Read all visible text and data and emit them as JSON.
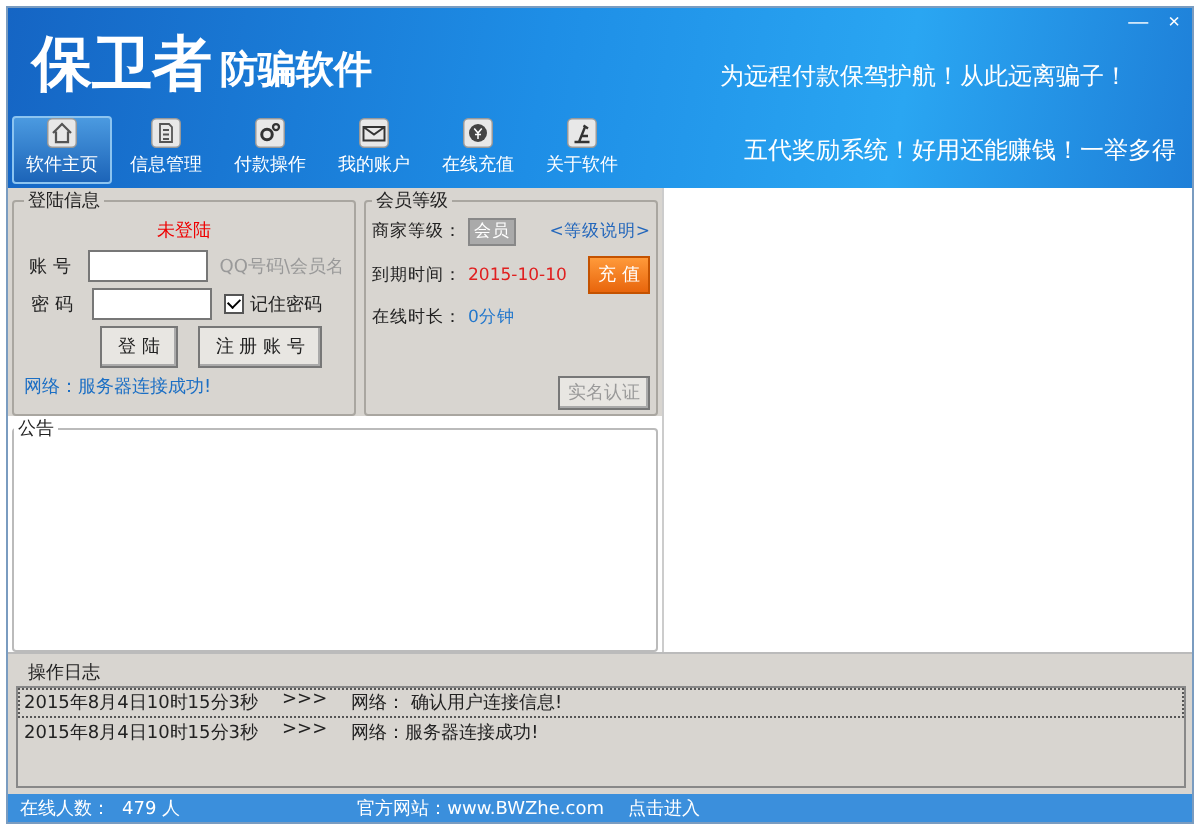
{
  "window": {
    "title_main": "保卫者",
    "title_sub": "防骗软件",
    "slogans": [
      "为远程付款保驾护航！从此远离骗子！",
      "五代奖励系统！好用还能赚钱！一举多得"
    ],
    "controls": [
      "—",
      "×"
    ]
  },
  "tabs": [
    {
      "label": "软件主页",
      "selected": true
    },
    {
      "label": "信息管理",
      "selected": false
    },
    {
      "label": "付款操作",
      "selected": false
    },
    {
      "label": "我的账户",
      "selected": false
    },
    {
      "label": "在线充值",
      "selected": false
    },
    {
      "label": "关于软件",
      "selected": false
    }
  ],
  "login": {
    "title": "登陆信息",
    "status": "未登陆",
    "account_label": "账 号",
    "account_hint": "QQ号码\\会员名",
    "password_label": "密 码",
    "remember": {
      "label": "记住密码",
      "checked": true
    },
    "buttons": [
      "登 陆",
      "注 册 账 号"
    ],
    "network": "网络：服务器连接成功!"
  },
  "member": {
    "title": "会员等级",
    "level_label": "商家等级：",
    "level_badge": "会员",
    "level_link": "<等级说明>",
    "expiry_label": "到期时间：",
    "expiry": "2015-10-10",
    "recharge_button": "充 值",
    "online_label": "在线时长：",
    "online": "0分钟",
    "verify_button": {
      "label": "实名认证",
      "disabled": true
    }
  },
  "announcement": {
    "title": "公告"
  },
  "log": {
    "title": "操作日志",
    "rows": [
      {
        "time": "2015年8月4日10时15分3秒",
        "sep": ">>>",
        "message": "网络： 确认用户连接信息!",
        "selected": true
      },
      {
        "time": "2015年8月4日10时15分3秒",
        "sep": ">>>",
        "message": "网络：服务器连接成功!",
        "selected": false
      }
    ]
  },
  "status_bar": {
    "online_label": "在线人数：",
    "online_count": "479 人",
    "site_label": "官方网站：www.BWZhe.com",
    "enter_link": "点击进入"
  }
}
